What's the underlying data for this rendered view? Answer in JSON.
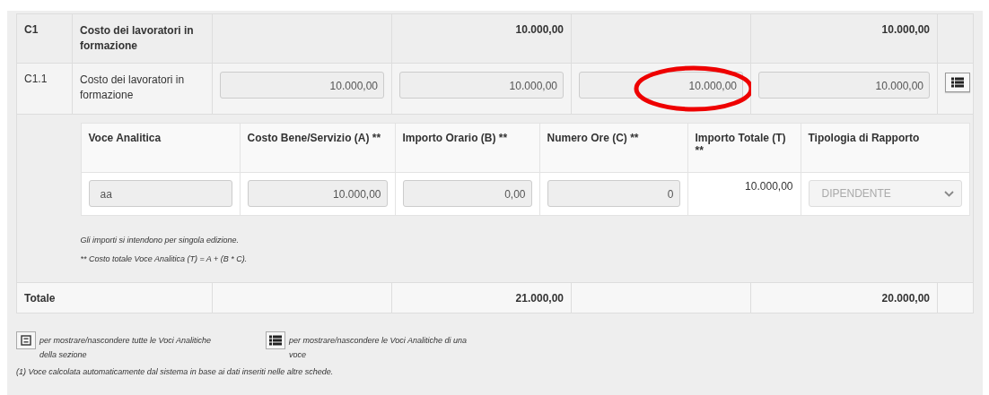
{
  "table": {
    "rows": [
      {
        "kind": "group",
        "code": "C1",
        "description": "Costo dei lavoratori in formazione",
        "cells": [
          "",
          "10.000,00",
          "",
          "10.000,00"
        ]
      },
      {
        "kind": "item",
        "code": "C1.1",
        "description": "Costo dei lavoratori in formazione",
        "cells": [
          {
            "value": "10.000,00",
            "circled": false
          },
          {
            "value": "10.000,00",
            "circled": false
          },
          {
            "value": "10.000,00",
            "circled": true
          },
          {
            "value": "10.000,00",
            "circled": false
          }
        ]
      },
      {
        "kind": "detail",
        "columns": [
          "Voce Analitica",
          "Costo Bene/Servizio (A) **",
          "Importo Orario (B) **",
          "Numero Ore (C) **",
          "Importo Totale (T) **",
          "Tipologia di Rapporto"
        ],
        "entry": {
          "voce": "aa",
          "costo": "10.000,00",
          "orario": "0,00",
          "ore": "0",
          "totale": "10.000,00",
          "tipologia": "DIPENDENTE"
        },
        "notes": [
          "Gli importi si intendono per singola edizione.",
          "** Costo totale Voce Analitica (T) = A + (B * C)."
        ]
      },
      {
        "kind": "total",
        "code": "Totale",
        "cells": [
          "",
          "21.000,00",
          "",
          "20.000,00"
        ]
      }
    ]
  },
  "legend": [
    {
      "kind": "all",
      "text": "per mostrare/nascondere tutte le Voci Analitiche della sezione"
    },
    {
      "kind": "one",
      "text": "per mostrare/nascondere le Voci Analitiche di una voce"
    }
  ],
  "footnote": "(1) Voce calcolata automaticamente dal sistema in base ai dati inseriti nelle altre schede."
}
